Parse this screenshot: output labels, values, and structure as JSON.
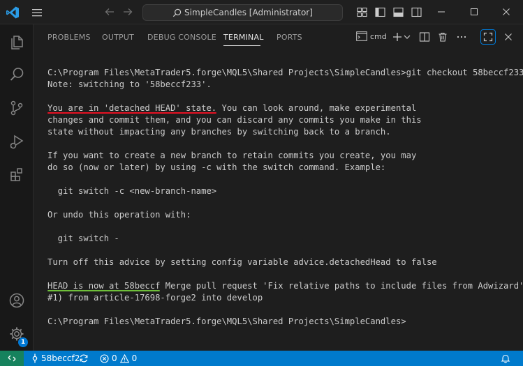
{
  "titlebar": {
    "search_text": "SimpleCandles [Administrator]"
  },
  "panel": {
    "tabs": [
      {
        "label": "PROBLEMS"
      },
      {
        "label": "OUTPUT"
      },
      {
        "label": "DEBUG CONSOLE"
      },
      {
        "label": "TERMINAL"
      },
      {
        "label": "PORTS"
      }
    ],
    "active_tab": "TERMINAL",
    "terminal_profile": "cmd"
  },
  "terminal": {
    "lines": [
      "C:\\Program Files\\MetaTrader5.forge\\MQL5\\Shared Projects\\SimpleCandles>git checkout 58beccf233",
      "Note: switching to '58beccf233'.",
      "",
      "",
      "changes and commit them, and you can discard any commits you make in this",
      "state without impacting any branches by switching back to a branch.",
      "",
      "If you want to create a new branch to retain commits you create, you may",
      "do so (now or later) by using -c with the switch command. Example:",
      "",
      "  git switch -c <new-branch-name>",
      "",
      "Or undo this operation with:",
      "",
      "  git switch -",
      "",
      "Turn off this advice by setting config variable advice.detachedHead to false",
      "",
      "",
      "#1) from article-17698-forge2 into develop",
      "",
      "C:\\Program Files\\MetaTrader5.forge\\MQL5\\Shared Projects\\SimpleCandles>"
    ],
    "detached_highlight": "You are in 'detached HEAD' state.",
    "detached_rest": " You can look around, make experimental",
    "head_highlight": "HEAD is now at 58beccf",
    "head_rest": " Merge pull request 'Fix relative paths to include files from Adwizard' ("
  },
  "statusbar": {
    "branch": "58beccf2",
    "errors": "0",
    "warnings": "0"
  },
  "activitybar": {
    "settings_badge": "1"
  },
  "colors": {
    "accent": "#0078d4",
    "statusbar": "#007acc",
    "remote": "#16825d",
    "underline_red": "#e81123",
    "underline_green": "#6fbf3a"
  }
}
